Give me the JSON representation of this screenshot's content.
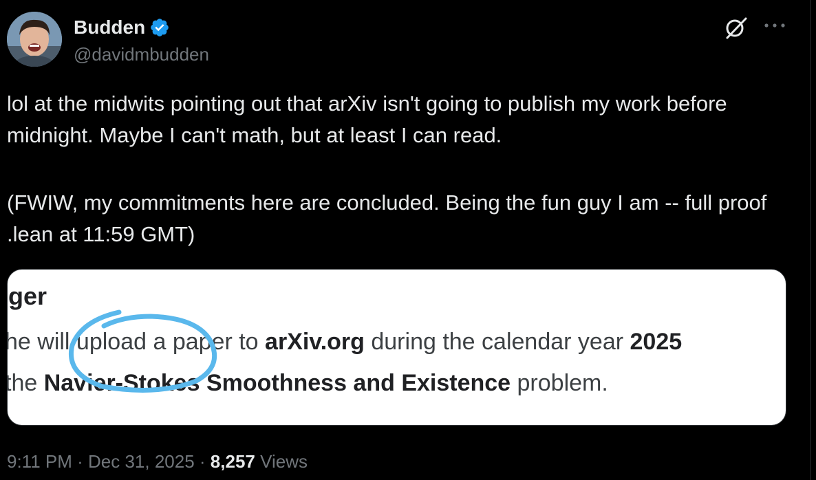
{
  "author": {
    "display_name": "Budden",
    "handle": "@davidmbudden",
    "verified": true,
    "verified_color": "#1d9bf0"
  },
  "header_actions": {
    "grok_icon": "grok-icon",
    "more_icon": "more-icon"
  },
  "tweet": {
    "paragraph_1": "lol at the midwits pointing out that arXiv isn't going to publish my work before midnight. Maybe I can't math, but at least I can read.",
    "paragraph_2": "(FWIW, my commitments here are concluded. Being the fun guy I am -- full proof .lean at 11:59 GMT)"
  },
  "media": {
    "heading_fragment": "ger",
    "line1": {
      "part1": "he will upload a paper to ",
      "bold1": "arXiv.org",
      "part2": " during the calendar year ",
      "bold2": "2025"
    },
    "line2": {
      "part1": "the ",
      "bold1": "Navier-Stokes Smoothness and Existence",
      "part2": " problem."
    },
    "annotation_color": "#5ab8ec"
  },
  "meta": {
    "time": "9:11 PM",
    "separator": " · ",
    "date": "Dec 31, 2025",
    "views_count": "8,257",
    "views_label": " Views"
  }
}
